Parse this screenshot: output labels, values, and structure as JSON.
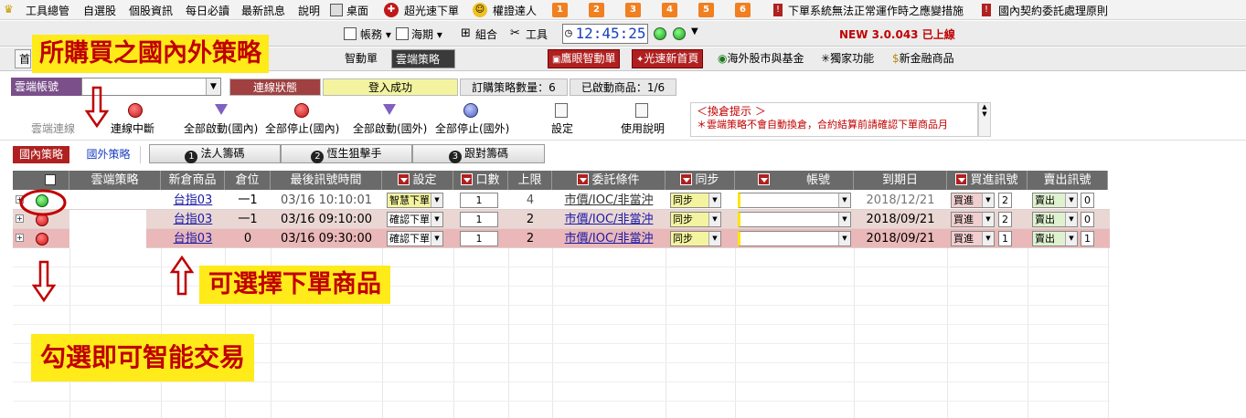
{
  "menubar": {
    "items": [
      "工具總管",
      "自選股",
      "個股資訊",
      "每日必讀",
      "最新訊息",
      "說明",
      "桌面",
      "超光速下單",
      "權證達人"
    ],
    "numbers": [
      "1",
      "2",
      "3",
      "4",
      "5",
      "6"
    ],
    "notice1": "下單系統無法正常運作時之應變措施",
    "notice2": "國內契約委託處理原則"
  },
  "toolbar": {
    "items": [
      "帳務",
      "海期",
      "組合",
      "工具"
    ],
    "clock": "12:45:25",
    "version": "NEW 3.0.043 已上線"
  },
  "toolbar2": {
    "first": "首",
    "smart": "智動單",
    "cloud": "雲端策略",
    "btn1": "鷹眼智動單",
    "btn2": "光速新首頁",
    "btn3": "海外股市與基金",
    "btn4": "獨家功能",
    "btn5": "新金融商品"
  },
  "account": {
    "label": "雲端帳號",
    "value": "",
    "conn_status_label": "連線狀態",
    "login_status": "登入成功",
    "ordered_count": "訂購策略數量：6",
    "started_count": "已啟動商品：1/6"
  },
  "actions": {
    "connect": "雲端連線",
    "disconnect": "連線中斷",
    "start_all_dom": "全部啟動(國內)",
    "stop_all_dom": "全部停止(國內)",
    "start_all_for": "全部啟動(國外)",
    "stop_all_for": "全部停止(國外)",
    "settings": "設定",
    "manual": "使用說明"
  },
  "hint": {
    "title": "＜換倉提示 ＞",
    "text": "＊雲端策略不會自動換倉，合約結算前請確認下單商品月"
  },
  "strategy_tabs": {
    "domestic": "國內策略",
    "foreign": "國外策略",
    "sub1": "法人籌碼",
    "sub2": "恆生狙擊手",
    "sub3": "跟對籌碼"
  },
  "grid": {
    "headers": [
      "雲端策略",
      "新倉商品",
      "倉位",
      "最後訊號時間",
      "設定",
      "口數",
      "上限",
      "委託條件",
      "同步",
      "帳號",
      "到期日",
      "買進訊號",
      "賣出訊號"
    ],
    "rows": [
      {
        "status": "green",
        "product": "台指03",
        "position": "一1",
        "time": "03/16 10:10:01",
        "setting": "智慧下單",
        "qty": "1",
        "limit": "4",
        "condition": "市價/IOC/非當沖",
        "sync": "同步",
        "account": "",
        "expiry": "2018/12/21",
        "buy": "買進",
        "buy_n": "2",
        "sell": "賣出",
        "sell_n": "0"
      },
      {
        "status": "red",
        "product": "台指03",
        "position": "一1",
        "time": "03/16 09:10:00",
        "setting": "確認下單",
        "qty": "1",
        "limit": "2",
        "condition": "市價/IOC/非當沖",
        "sync": "同步",
        "account": "",
        "expiry": "2018/09/21",
        "buy": "買進",
        "buy_n": "2",
        "sell": "賣出",
        "sell_n": "0"
      },
      {
        "status": "red",
        "product": "台指03",
        "position": "0",
        "time": "03/16 09:30:00",
        "setting": "確認下單",
        "qty": "1",
        "limit": "2",
        "condition": "市價/IOC/非當沖",
        "sync": "同步",
        "account": "",
        "expiry": "2018/09/21",
        "buy": "買進",
        "buy_n": "1",
        "sell": "賣出",
        "sell_n": "1"
      }
    ]
  },
  "annotations": {
    "purchased": "所購買之國內外策略",
    "selectable": "可選擇下單商品",
    "check_to_trade": "勾選即可智能交易"
  },
  "colors": {
    "red_accent": "#b02020",
    "header_gray": "#6a6a6a",
    "note_yellow": "#ffea1a"
  }
}
